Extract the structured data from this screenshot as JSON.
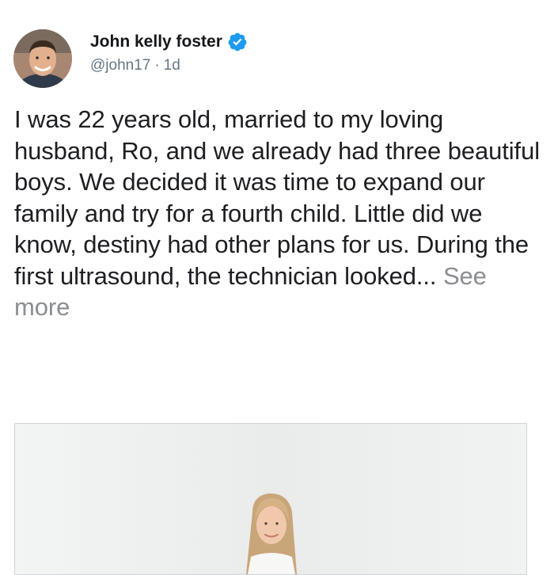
{
  "post": {
    "author": {
      "display_name": "John kelly foster",
      "handle": "@john17",
      "verified": true,
      "avatar_icon": "profile-photo"
    },
    "separator": "·",
    "time": "1d",
    "text": "I was 22 years old, married to my loving husband, Ro, and we already had three beautiful boys. We decided it was time to expand our family and try for a fourth child. Little did we know, destiny had other plans for us. During the first ultrasound, the technician looked...",
    "see_more_label": "See more",
    "media": {
      "type": "photo",
      "icon": "photo-woman-portrait"
    }
  },
  "colors": {
    "verified_badge": "#1d9bf0",
    "secondary_text": "#657786",
    "see_more": "#8a8d91",
    "primary_text": "#1c1e21"
  }
}
